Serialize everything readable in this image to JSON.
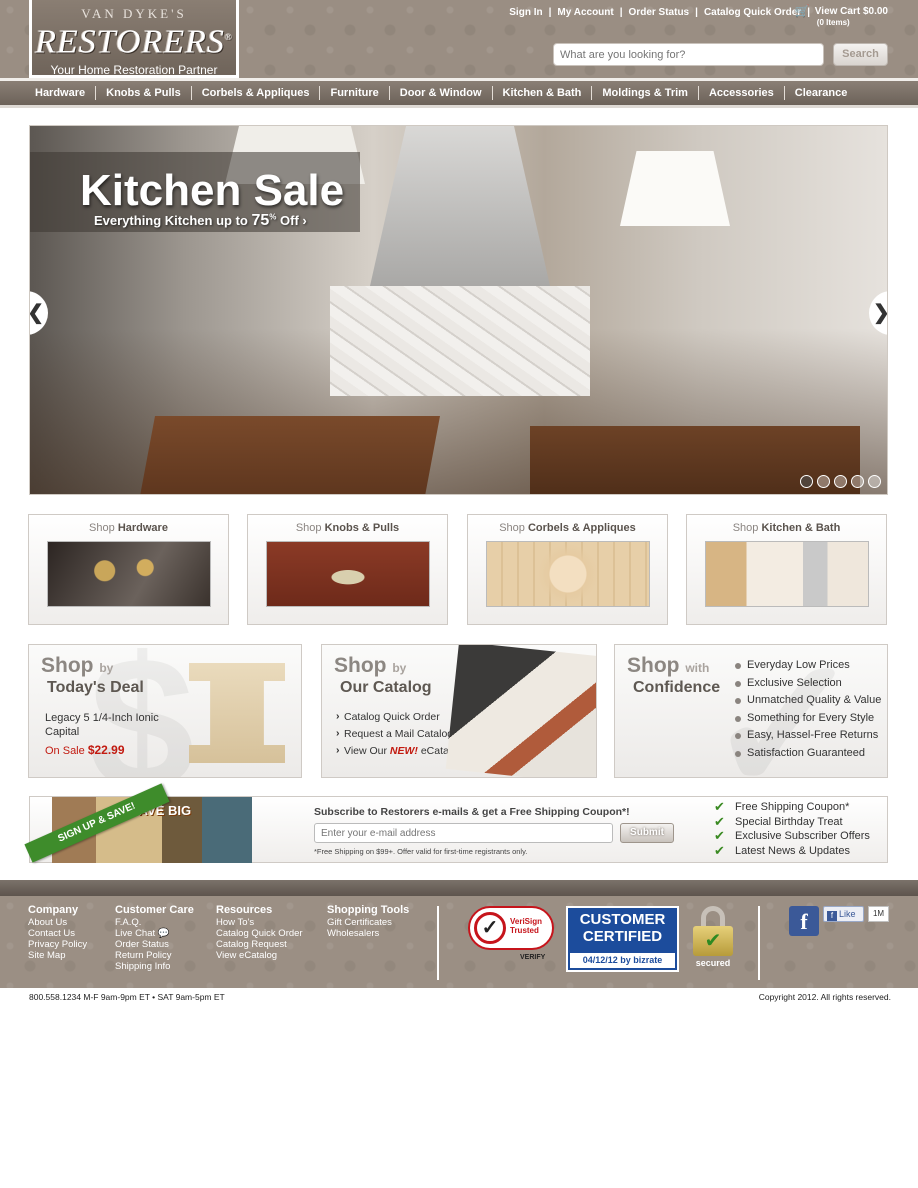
{
  "header": {
    "logo_top": "VAN DYKE'S",
    "logo_main": "RESTORERS",
    "logo_registered": "®",
    "tagline": "Your Home Restoration Partner",
    "top_links": [
      "Sign In",
      "My Account",
      "Order Status",
      "Catalog Quick Order"
    ],
    "cart_label": "View Cart  $0.00",
    "cart_items": "(0 Items)",
    "search_placeholder": "What are you looking for?",
    "search_button": "Search"
  },
  "nav": [
    "Hardware",
    "Knobs & Pulls",
    "Corbels & Appliques",
    "Furniture",
    "Door & Window",
    "Kitchen & Bath",
    "Moldings & Trim",
    "Accessories",
    "Clearance"
  ],
  "hero": {
    "title": "Kitchen Sale",
    "subtitle_pre": "Everything Kitchen up to",
    "subtitle_pct": "75",
    "subtitle_pct_sign": "%",
    "subtitle_post": "Off ›",
    "prev": "❮",
    "next": "❯",
    "slide_count": 5,
    "active_slide": 1
  },
  "tiles": [
    {
      "prefix": "Shop",
      "name": "Hardware"
    },
    {
      "prefix": "Shop",
      "name": "Knobs & Pulls"
    },
    {
      "prefix": "Shop",
      "name": "Corbels & Appliques"
    },
    {
      "prefix": "Shop",
      "name": "Kitchen & Bath"
    }
  ],
  "deal": {
    "shop": "Shop",
    "by": "by",
    "heading": "Today's Deal",
    "product": "Legacy 5 1/4-Inch Ionic Capital",
    "sale_label": "On Sale",
    "price": "$22.99"
  },
  "catalog": {
    "shop": "Shop",
    "by": "by",
    "heading": "Our Catalog",
    "items": [
      "Catalog Quick Order",
      "Request a Mail Catalog"
    ],
    "view_pre": "View Our",
    "view_new": "NEW!",
    "view_post": "eCatalog"
  },
  "confidence": {
    "shop": "Shop",
    "with": "with",
    "heading": "Confidence",
    "items": [
      "Everyday Low Prices",
      "Exclusive Selection",
      "Unmatched Quality & Value",
      "Something for Every Style",
      "Easy, Hassel-Free Returns",
      "Satisfaction Guaranteed"
    ]
  },
  "subscribe": {
    "ribbon": "SIGN UP & SAVE!",
    "promo": "SAVE BIG",
    "title": "Subscribe to Restorers e-mails & get a Free Shipping Coupon*!",
    "placeholder": "Enter your e-mail address",
    "button": "Submit",
    "fine_print": "*Free Shipping on $99+. Offer valid for first-time registrants only.",
    "benefits": [
      "Free Shipping Coupon*",
      "Special Birthday Treat",
      "Exclusive Subscriber Offers",
      "Latest News & Updates"
    ]
  },
  "footer": {
    "columns": [
      {
        "heading": "Company",
        "links": [
          "About Us",
          "Contact Us",
          "Privacy Policy",
          "Site Map"
        ]
      },
      {
        "heading": "Customer Care",
        "links": [
          "F.A.Q.",
          "Live Chat",
          "Order Status",
          "Return Policy",
          "Shipping Info"
        ]
      },
      {
        "heading": "Resources",
        "links": [
          "How To's",
          "Catalog Quick Order",
          "Catalog Request",
          "View eCatalog"
        ]
      },
      {
        "heading": "Shopping Tools",
        "links": [
          "Gift Certificates",
          "Wholesalers"
        ]
      }
    ],
    "verisign_line1": "VeriSign",
    "verisign_line2": "Trusted",
    "verisign_verify": "VERIFY",
    "certified_line1": "CUSTOMER",
    "certified_line2": "CERTIFIED",
    "certified_date": "04/12/12 by bizrate",
    "secured": "secured",
    "fb_like": "Like",
    "fb_count": "1M",
    "phone_hours": "800.558.1234  M-F 9am-9pm ET • SAT 9am-5pm ET",
    "copyright": "Copyright 2012.  All rights reserved."
  }
}
